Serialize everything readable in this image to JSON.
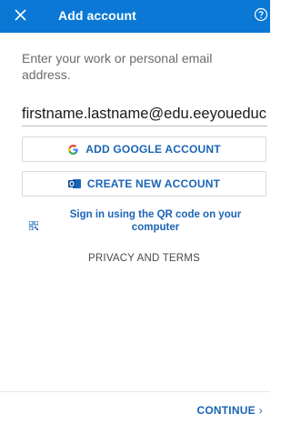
{
  "header": {
    "title": "Add account",
    "close_icon": "close-icon",
    "help_icon": "help-icon",
    "background": "#0a78d4"
  },
  "prompt": "Enter your work or personal email address.",
  "email_field": {
    "value": "firstname.lastname@edu.eeyoueduc"
  },
  "google_button": {
    "label": "ADD GOOGLE ACCOUNT",
    "icon": "google-icon"
  },
  "create_button": {
    "label": "CREATE NEW ACCOUNT",
    "icon": "outlook-icon"
  },
  "qr_signin": {
    "label": "Sign in using the QR code on your computer",
    "icon": "qr-code-icon"
  },
  "privacy_link": "PRIVACY AND TERMS",
  "footer": {
    "continue_label": "CONTINUE",
    "continue_icon": "chevron-right-icon"
  },
  "colors": {
    "accent": "#1b64b5",
    "header": "#0a78d4"
  }
}
